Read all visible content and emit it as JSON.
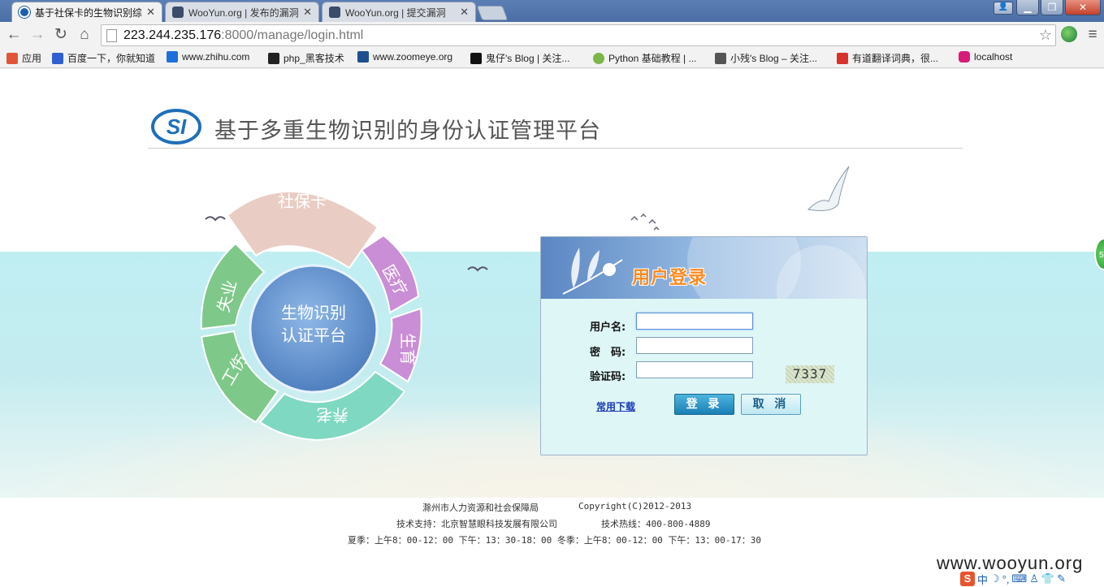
{
  "browser": {
    "tabs": [
      {
        "title": "基于社保卡的生物识别综合",
        "active": true
      },
      {
        "title": "WooYun.org | 发布的漏洞",
        "active": false
      },
      {
        "title": "WooYun.org | 提交漏洞",
        "active": false
      }
    ],
    "url_host": "223.244.235.176",
    "url_rest": ":8000/manage/login.html",
    "bookmarks": [
      {
        "label": "应用",
        "icon": "apps-icon",
        "color": "#e0553a"
      },
      {
        "label": "百度一下，你就知道",
        "icon": "baidu-icon",
        "color": "#2f5fd0"
      },
      {
        "label": "www.zhihu.com",
        "icon": "zhihu-icon",
        "color": "#1f6fd8"
      },
      {
        "label": "php_黑客技术",
        "icon": "cap-icon",
        "color": "#222"
      },
      {
        "label": "www.zoomeye.org",
        "icon": "zoomeye-icon",
        "color": "#1f4f8f"
      },
      {
        "label": "鬼仔's Blog | 关注...",
        "icon": "ghost-icon",
        "color": "#111"
      },
      {
        "label": "Python 基础教程 | ...",
        "icon": "python-icon",
        "color": "#7ab648"
      },
      {
        "label": "小残's Blog – 关注...",
        "icon": "blog-icon",
        "color": "#555"
      },
      {
        "label": "有道翻译词典，很...",
        "icon": "youdao-icon",
        "color": "#d9322b"
      },
      {
        "label": "localhost",
        "icon": "localhost-icon",
        "color": "#d81b7a"
      }
    ]
  },
  "page": {
    "title": "基于多重生物识别的身份认证管理平台",
    "wheel": {
      "center_line1": "生物识别",
      "center_line2": "认证平台",
      "segments": [
        "社保卡",
        "医疗",
        "生育",
        "养老",
        "工伤",
        "失业"
      ]
    },
    "login": {
      "heading": "用户登录",
      "username_label": "用户名:",
      "password_label": "密　码:",
      "captcha_label": "验证码:",
      "username_value": "",
      "password_value": "",
      "captcha_value": "",
      "captcha_text": "7337",
      "download_link": "常用下载",
      "login_button": "登 录",
      "cancel_button": "取 消"
    },
    "footer": {
      "org": "滁州市人力资源和社会保障局",
      "copyright": "Copyright(C)2012-2013",
      "support": "技术支持：北京智慧眼科技发展有限公司",
      "hotline": "技术热线：400-800-4889",
      "hours": "夏季：上午8：00-12：00 下午：13：30-18：00 冬季：上午8：00-12：00 下午：13：00-17：30"
    }
  },
  "overlay": {
    "watermark": "www.wooyun.org",
    "ime_label": "中",
    "ime_badge": "S",
    "side_widget": "5"
  }
}
